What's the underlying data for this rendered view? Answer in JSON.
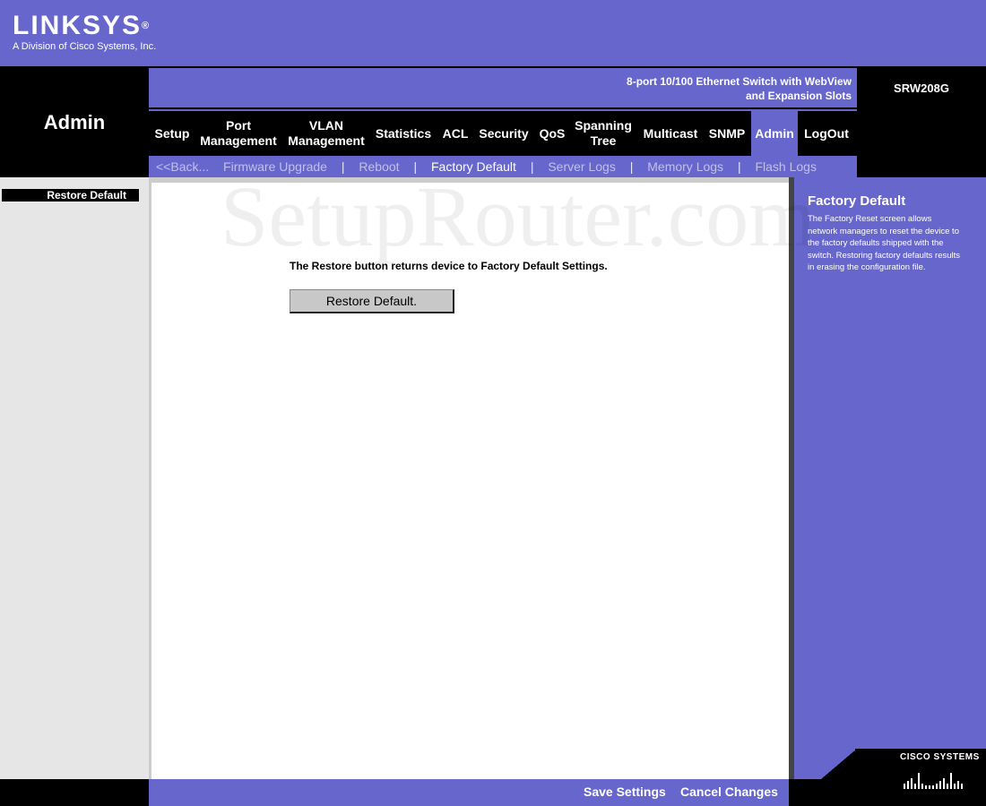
{
  "brand": {
    "name": "LINKSYS",
    "registered": "®",
    "tagline": "A Division of Cisco Systems, Inc."
  },
  "section_title": "Admin",
  "product": {
    "line1": "8-port 10/100 Ethernet Switch with WebView",
    "line2": "and Expansion Slots",
    "model": "SRW208G"
  },
  "nav": {
    "setup": "Setup",
    "port_mgmt_1": "Port",
    "port_mgmt_2": "Management",
    "vlan_mgmt_1": "VLAN",
    "vlan_mgmt_2": "Management",
    "statistics": "Statistics",
    "acl": "ACL",
    "security": "Security",
    "qos": "QoS",
    "spanning_1": "Spanning",
    "spanning_2": "Tree",
    "multicast": "Multicast",
    "snmp": "SNMP",
    "admin": "Admin",
    "logout": "LogOut"
  },
  "subnav": {
    "back": "<<Back...",
    "firmware": "Firmware Upgrade",
    "reboot": "Reboot",
    "factory": "Factory Default",
    "server_logs": "Server Logs",
    "memory_logs": "Memory Logs",
    "flash_logs": "Flash Logs",
    "separator": "|"
  },
  "sidebar": {
    "item": "Restore Default"
  },
  "content": {
    "message": "The Restore button returns device to Factory Default Settings.",
    "button": "Restore Default."
  },
  "watermark": "SetupRouter.com",
  "help": {
    "title": "Factory Default",
    "body": "The Factory Reset screen allows network managers to reset the device to the factory defaults shipped with the switch. Restoring factory defaults results in erasing the configuration file."
  },
  "footer": {
    "save": "Save Settings",
    "cancel": "Cancel Changes",
    "cisco": "CISCO SYSTEMS"
  },
  "colors": {
    "accent": "#6666cc",
    "black": "#000000",
    "panel": "#e6e6e6"
  }
}
